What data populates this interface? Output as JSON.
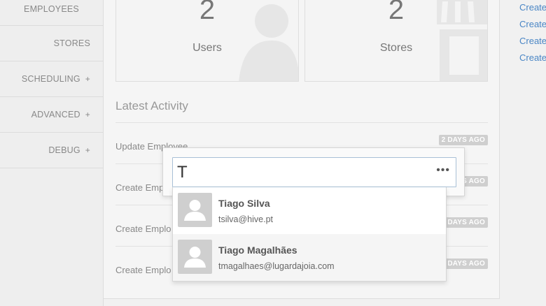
{
  "sidebar": {
    "items": [
      {
        "label": "EMPLOYEES",
        "expandable": false
      },
      {
        "label": "STORES",
        "expandable": false
      },
      {
        "label": "SCHEDULING",
        "expandable": true
      },
      {
        "label": "ADVANCED",
        "expandable": true
      },
      {
        "label": "DEBUG",
        "expandable": true
      }
    ],
    "plus": "+"
  },
  "stats": [
    {
      "value": "2",
      "label": "Users"
    },
    {
      "value": "2",
      "label": "Stores"
    }
  ],
  "activity": {
    "title": "Latest Activity",
    "rows": [
      {
        "text": "Update Employee",
        "badge": "2 DAYS AGO"
      },
      {
        "text": "Create Emp",
        "badge": "2 DAYS AGO"
      },
      {
        "text": "Create Emplo",
        "badge": "2 DAYS AGO"
      },
      {
        "text": "Create Emplo",
        "badge": "2 DAYS AGO"
      }
    ]
  },
  "right_links": [
    "Create",
    "Create",
    "Create",
    "Create"
  ],
  "search": {
    "value": "T",
    "more": "•••",
    "results": [
      {
        "name": "Tiago Silva",
        "email": "tsilva@hive.pt"
      },
      {
        "name": "Tiago Magalhães",
        "email": "tmagalhaes@lugardajoia.com"
      }
    ]
  },
  "colors": {
    "link": "#4a86c5",
    "badge": "#cfcfcf",
    "focus_border": "#a9c0d6"
  }
}
